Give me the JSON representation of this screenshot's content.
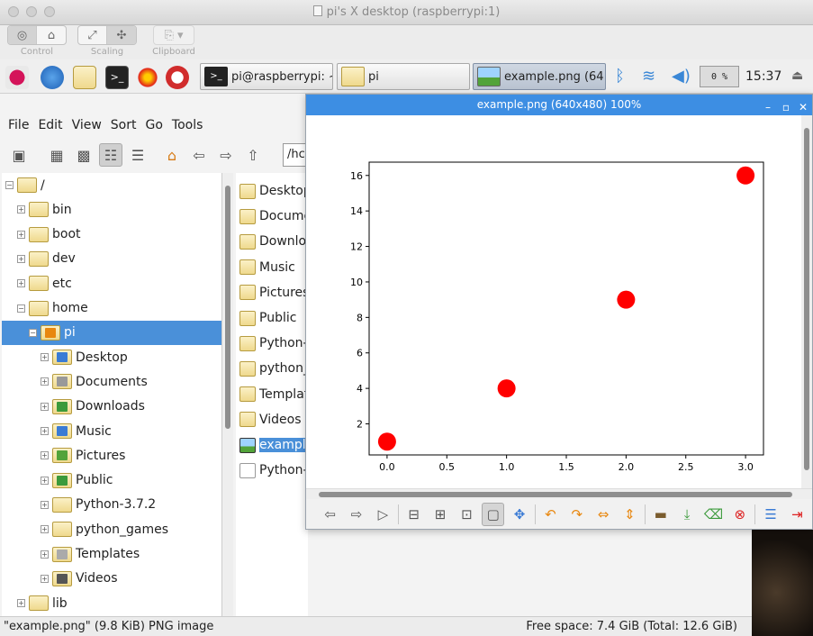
{
  "vnc": {
    "title": "pi's X desktop (raspberrypi:1)",
    "groups": [
      {
        "label": "Control"
      },
      {
        "label": "Scaling"
      },
      {
        "label": "Clipboard"
      }
    ]
  },
  "panel": {
    "tasks": [
      {
        "label": "pi@raspberrypi: ~"
      },
      {
        "label": "pi"
      },
      {
        "label": "example.png (64..."
      }
    ],
    "cpu": "0 %",
    "clock": "15:37"
  },
  "file_manager": {
    "menu": [
      "File",
      "Edit",
      "View",
      "Sort",
      "Go",
      "Tools"
    ],
    "path": "/hc",
    "tree": [
      {
        "label": "/",
        "icon": "folder-icon"
      },
      {
        "label": "bin",
        "icon": "folder-icon"
      },
      {
        "label": "boot",
        "icon": "folder-icon"
      },
      {
        "label": "dev",
        "icon": "folder-icon"
      },
      {
        "label": "etc",
        "icon": "folder-icon"
      },
      {
        "label": "home",
        "icon": "folder-icon"
      },
      {
        "label": "pi",
        "icon": "home-folder-icon"
      },
      {
        "label": "Desktop",
        "icon": "desktop-folder-icon"
      },
      {
        "label": "Documents",
        "icon": "documents-folder-icon"
      },
      {
        "label": "Downloads",
        "icon": "downloads-folder-icon"
      },
      {
        "label": "Music",
        "icon": "music-folder-icon"
      },
      {
        "label": "Pictures",
        "icon": "pictures-folder-icon"
      },
      {
        "label": "Public",
        "icon": "public-folder-icon"
      },
      {
        "label": "Python-3.7.2",
        "icon": "folder-icon"
      },
      {
        "label": "python_games",
        "icon": "folder-icon"
      },
      {
        "label": "Templates",
        "icon": "templates-folder-icon"
      },
      {
        "label": "Videos",
        "icon": "videos-folder-icon"
      },
      {
        "label": "lib",
        "icon": "folder-icon"
      }
    ],
    "files": [
      {
        "label": "Desktop",
        "icon": "desktop-folder-icon"
      },
      {
        "label": "Docume",
        "icon": "documents-folder-icon"
      },
      {
        "label": "Downlo",
        "icon": "downloads-folder-icon"
      },
      {
        "label": "Music",
        "icon": "music-folder-icon"
      },
      {
        "label": "Pictures",
        "icon": "pictures-folder-icon"
      },
      {
        "label": "Public",
        "icon": "public-folder-icon"
      },
      {
        "label": "Python-",
        "icon": "folder-icon"
      },
      {
        "label": "python_",
        "icon": "folder-icon"
      },
      {
        "label": "Templat",
        "icon": "templates-folder-icon"
      },
      {
        "label": "Videos",
        "icon": "videos-folder-icon"
      },
      {
        "label": "example",
        "icon": "image-file-icon"
      },
      {
        "label": "Python-",
        "icon": "script-file-icon"
      }
    ],
    "status_left": "\"example.png\" (9.8 KiB) PNG image",
    "status_right": "Free space: 7.4 GiB (Total: 12.6 GiB)"
  },
  "viewer": {
    "title": "example.png (640x480) 100%"
  },
  "chart_data": {
    "type": "scatter",
    "x": [
      0.0,
      1.0,
      2.0,
      3.0
    ],
    "y": [
      1,
      4,
      9,
      16
    ],
    "marker_color": "#ff0000",
    "xlim": [
      -0.15,
      3.15
    ],
    "ylim": [
      0.25,
      16.75
    ],
    "xticks": [
      "0.0",
      "0.5",
      "1.0",
      "1.5",
      "2.0",
      "2.5",
      "3.0"
    ],
    "yticks": [
      "2",
      "4",
      "6",
      "8",
      "10",
      "12",
      "14",
      "16"
    ],
    "title": "",
    "xlabel": "",
    "ylabel": ""
  }
}
